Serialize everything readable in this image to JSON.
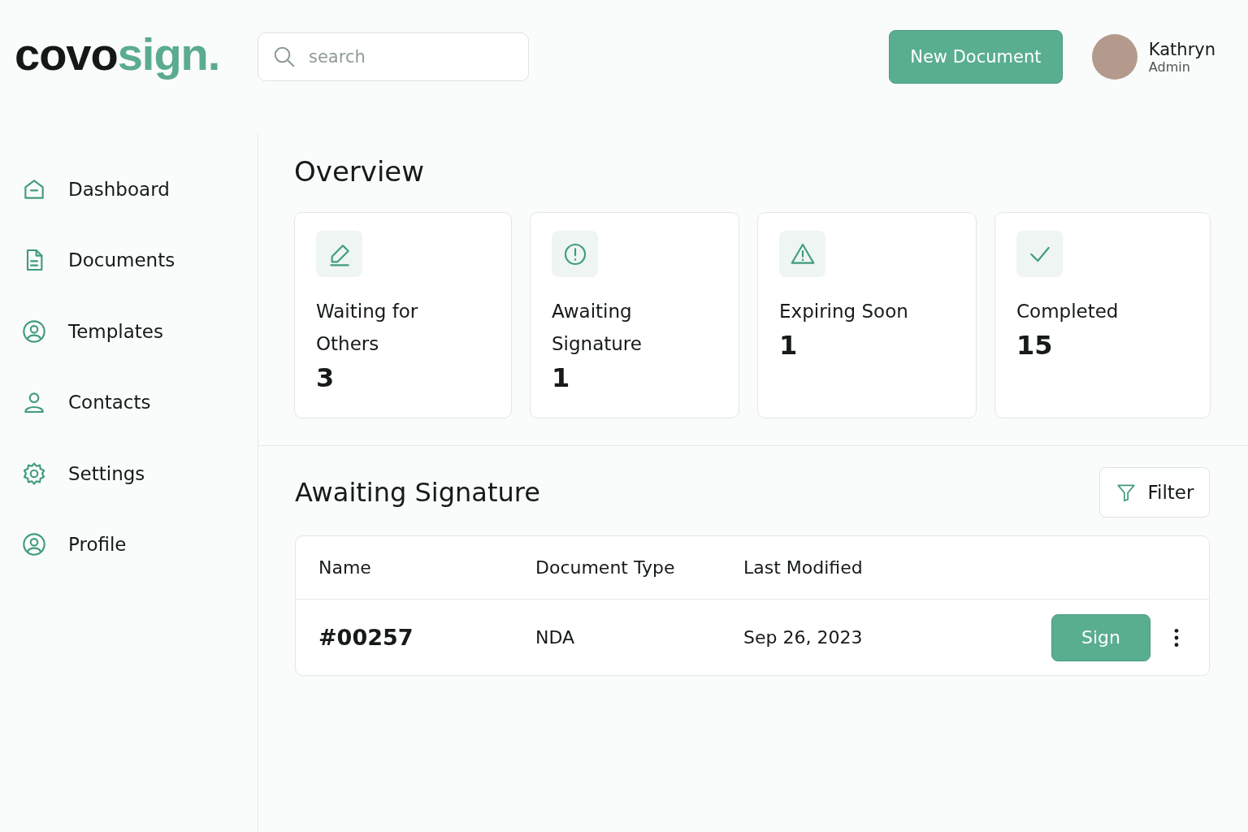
{
  "logo": [
    {
      "text": "covo",
      "kind": "dark"
    },
    {
      "text": "sign.",
      "kind": "accent"
    }
  ],
  "search": {
    "placeholder": "search"
  },
  "new_button": "New Document",
  "user": {
    "name": "Kathryn",
    "role": "Admin"
  },
  "sidebar": {
    "items": [
      {
        "label": "Dashboard",
        "kind": "home"
      },
      {
        "label": "Documents",
        "kind": "doc"
      },
      {
        "label": "Templates",
        "kind": "user-circle"
      },
      {
        "label": "Contacts",
        "kind": "user"
      },
      {
        "label": "Settings",
        "kind": "gear"
      },
      {
        "label": "Profile",
        "kind": "user-circle"
      }
    ]
  },
  "overview": {
    "title": "Overview",
    "cards": [
      {
        "kind": "pen",
        "label": "Waiting for Others",
        "count": "3"
      },
      {
        "kind": "alert-circle",
        "label": "Awaiting Signature",
        "count": "1"
      },
      {
        "kind": "warning",
        "label": "Expiring Soon",
        "count": "1"
      },
      {
        "kind": "check",
        "label": "Completed",
        "count": "15"
      }
    ]
  },
  "awaiting": {
    "title": "Awaiting Signature",
    "filter": "Filter",
    "table": {
      "columns": [
        "Name",
        "Document Type",
        "Last Modified"
      ],
      "rows": [
        {
          "cells": [
            "#00257",
            "NDA",
            "Sep 26, 2023"
          ],
          "action": "Sign"
        }
      ]
    }
  }
}
